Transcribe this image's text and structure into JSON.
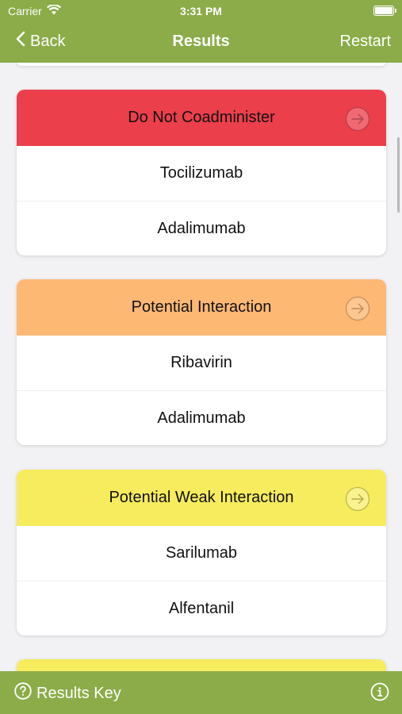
{
  "status_bar": {
    "carrier": "Carrier",
    "time": "3:31 PM"
  },
  "nav": {
    "back_label": "Back",
    "title": "Results",
    "restart_label": "Restart"
  },
  "colors": {
    "bar": "#8bac48",
    "do_not_coadminister": "#ec3f4c",
    "potential_interaction": "#fdb874",
    "potential_weak_interaction": "#f6ec5e"
  },
  "results": [
    {
      "header": "Do Not Coadminister",
      "color": "#ec3f4c",
      "drugs": [
        "Tocilizumab",
        "Adalimumab"
      ]
    },
    {
      "header": "Potential Interaction",
      "color": "#fdb874",
      "drugs": [
        "Ribavirin",
        "Adalimumab"
      ]
    },
    {
      "header": "Potential Weak Interaction",
      "color": "#f6ec5e",
      "drugs": [
        "Sarilumab",
        "Alfentanil"
      ]
    }
  ],
  "bottom_bar": {
    "results_key_label": "Results Key"
  }
}
